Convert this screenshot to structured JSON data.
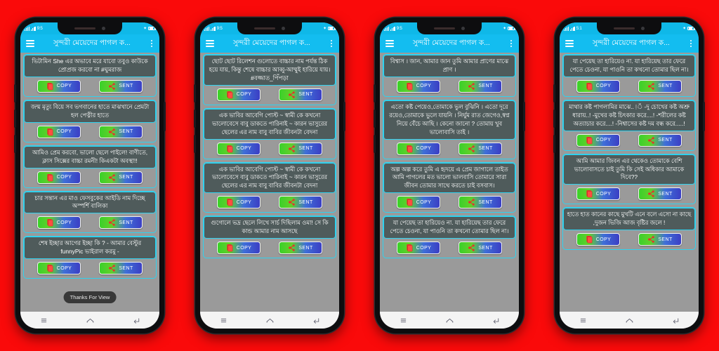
{
  "background_color": "#FA0A0A",
  "theme": {
    "appbar_color": "#13bdf0",
    "statusbar_color": "#0fb8e8",
    "card_border_color": "#2fd2ef",
    "card_text_bg": "#4f5b5b",
    "card_body_bg": "#9a9a9a",
    "button_gradient_from": "#3ad12a",
    "button_gradient_to": "#3b3fc4",
    "button_icon_color": "#e8302a"
  },
  "buttons": {
    "copy_label": "COPY",
    "sent_label": "SENT",
    "copy_icon": "copy-document-icon",
    "sent_icon": "share-nodes-icon"
  },
  "navbar": {
    "recents_icon": "recent-apps-icon",
    "home_icon": "home-icon",
    "back_icon": "back-icon"
  },
  "appbar": {
    "menu_icon": "hamburger-menu-icon",
    "overflow_icon": "overflow-menu-icon",
    "title": "সুন্দরী মেয়েদের পাগল ক..."
  },
  "phones": [
    {
      "id": "phone-1",
      "statusbar": {
        "time": "9:5",
        "left_icons": "signal-wifi-icons",
        "right_icons": "bluetooth-battery-icons",
        "battery": ""
      },
      "toast": "Thanks For View",
      "cards": [
        {
          "text": "ভিটামিন She এর অভাবে মরে যাবো তবুও কাউকে প্রোপ্রজ করবো না #ঘুমরাজ"
        },
        {
          "text": "জন্ম মৃত্যু বিয়ে সব ভগবানের হাতে মাঝখানে প্রেমটা হল পেত্নীর হাতে"
        },
        {
          "text": "আমিও প্রেম করবো, ভালো ছেলে পাইলে!  বাণীতে, ক্লাস সিক্সের বাচ্চা রমনী!  কিএকটা অবস্থা!!"
        },
        {
          "text": "চার সন্তান এর মাও ফেসবুকের আইডি নাম দিচ্ছে অস্পর্শি বালিকা"
        },
        {
          "text": "শেষ ইচ্ছার আগের ইচ্ছা কি ?  - আমার বেস্টুর funnyPic ভাইরাল করমু  -"
        }
      ]
    },
    {
      "id": "phone-2",
      "statusbar": {
        "time": "9:5",
        "left_icons": "signal-wifi-icons",
        "right_icons": "bluetooth-battery-icons",
        "battery": ""
      },
      "toast": null,
      "cards": [
        {
          "text": "ছোট ছোট রিলেশন গুলোতে বাচ্চার নাম   পর্যন্ত ঠিক হয়ে যায়, কিন্তু শেষে বাচ্চার   আব্বু-আম্মুই হারিয়ে যায়। #বজ্জাত_পিঁপড়া"
        },
        {
          "text": "এক ভাবির আবেগি পোস্ট  ~ স্বামী কে কখনো ভালোবেসে বাবু ডাকতে পারিনাই  ~ কারন ভাসুরের ছেলের এর নাম বাবু বাবির জীবনটা বেদনা"
        },
        {
          "text": "এক ভাবির আবেগি পোস্ট  ~ স্বামী কে কখনো ভালোবেসে বাবু ডাকতে পারিনাই  ~ কারন ভাসুরের ছেলের এর নাম বাবু বাবির জীবনটা বেদনা"
        },
        {
          "text": "গুগোলে ভদ্র ছেলে লিখে সার্চ দিছিলাম ওমা!   সে কি কান্ড আমার নাম আসছে"
        }
      ]
    },
    {
      "id": "phone-3",
      "statusbar": {
        "time": "9:5",
        "left_icons": "signal-wifi-icons",
        "right_icons": "bluetooth-battery-icons",
        "battery": ""
      },
      "toast": null,
      "cards": [
        {
          "text": "বিশ্বাস ।  জান, আমার জান  তুমি আমার প্রাণের মাঝে প্রাণ ।"
        },
        {
          "text": "এতো কষ্ট পেয়েও,তোমাকে ভুল বুঝিনি ।  এতো দূরে রয়েও,তোমাকে ভুলে যায়নি ।  নির্ঘুম রাত জেগেও,স্বপ্ন নিয়ে বেঁচে আছি ।  কেনো জানো ? তোমায় খুব ভালোবাসি তাই ।"
        },
        {
          "text": "অল্প অল্প করে তুমি এ হৃদয়ে এ প্রেম জাগালে  তাইত আমি পাগলের মত ভালো ভালবাসি তোমারে  সারা জীবন তোমার সাথে করতে চাই বসবাস।"
        },
        {
          "text": "যা পেয়েছ তা হারিয়েও না. যা হারিয়েছ তার  ফেরে পেতে চেওনা, যা পাওনি তা কখনো তোমার ছিল না।"
        }
      ]
    },
    {
      "id": "phone-4",
      "statusbar": {
        "time": "5:1",
        "left_icons": "signal-wifi-icons",
        "right_icons": "bluetooth-battery-icons",
        "battery": ""
      },
      "toast": null,
      "cards": [
        {
          "text": "যা পেয়েছ তা হারিয়েও না. যা হারিয়েছ তার  ফেরে পেতে চেওনা, যা পাওনি তা কখনো তোমার ছিল না।"
        },
        {
          "text": "মাথার কষ্ট পাগলামির মাঝে..!ঁ -দু চোখের কষ্ট অশ্রু ধারায়..!  -মুখের কষ্ট চিৎকার করে....!  -শরীলের কষ্ট অত্যাচার করে....!  -নিশ্বাসের কষ্ট দম বন্ধ করে.....!"
        },
        {
          "text": "আমি আমার জিবন এর থেকেও তোমাকে বেশি ভালোবাসতে চাই  তুমি কি সেই অধিকার আমাকে দিবে??"
        },
        {
          "text": "হাতে হাত কানের কাছে মুখটি এনে বলে  এসো না কাছে ,দুজন ভিজি আজ বৃষ্টির জলে !"
        }
      ]
    }
  ]
}
